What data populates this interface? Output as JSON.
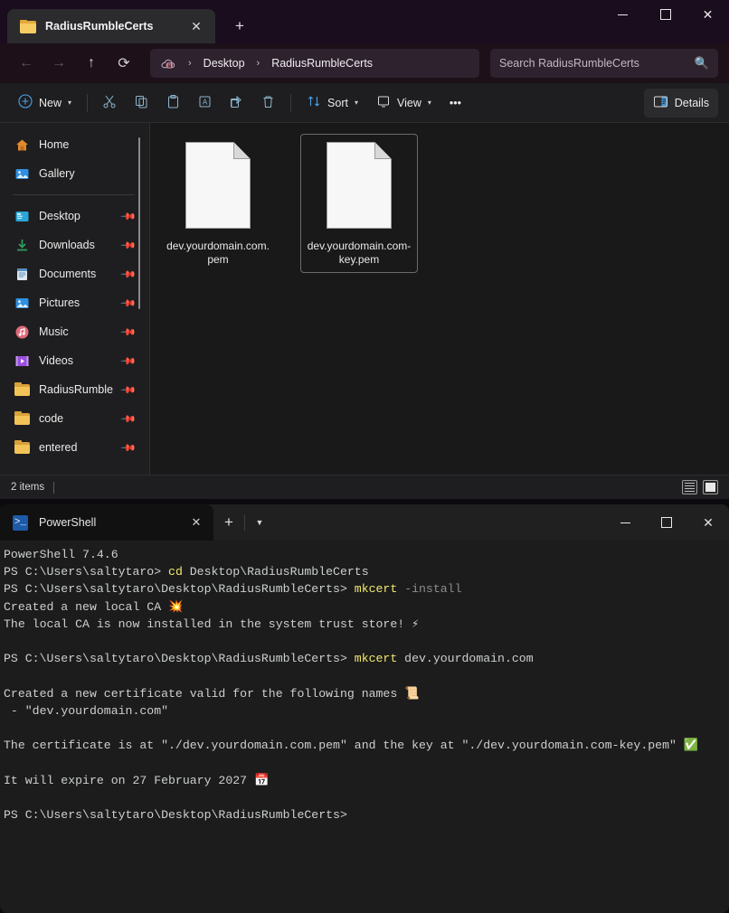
{
  "explorer": {
    "tab": {
      "title": "RadiusRumbleCerts",
      "folder_icon": "folder-icon",
      "close_icon": "close-icon"
    },
    "new_tab_icon": "plus-icon",
    "window_controls": {
      "minimize": "minimize-icon",
      "maximize": "maximize-icon",
      "close": "close-icon"
    },
    "nav": {
      "back_icon": "arrow-left-icon",
      "forward_icon": "arrow-right-icon",
      "up_icon": "arrow-up-icon",
      "refresh_icon": "refresh-icon"
    },
    "address": {
      "root_icon": "onedrive-lock-icon",
      "separator": "›",
      "crumbs": [
        "Desktop",
        "RadiusRumbleCerts"
      ]
    },
    "search": {
      "placeholder": "Search RadiusRumbleCerts",
      "icon": "search-icon"
    },
    "toolbar": {
      "new_label": "New",
      "new_icon": "plus-circle-icon",
      "cut_icon": "scissors-icon",
      "copy_icon": "copy-icon",
      "paste_icon": "paste-icon",
      "rename_icon": "rename-icon",
      "share_icon": "share-icon",
      "delete_icon": "trash-icon",
      "sort_label": "Sort",
      "sort_icon": "sort-arrows-icon",
      "view_label": "View",
      "view_icon": "monitor-icon",
      "more_label": "•••",
      "details_label": "Details",
      "details_icon": "details-pane-icon",
      "chevron": "⌄"
    },
    "sidebar": {
      "items": [
        {
          "label": "Home",
          "icon": "home-icon",
          "pinned": false
        },
        {
          "label": "Gallery",
          "icon": "gallery-icon",
          "pinned": false
        },
        {
          "divider": true
        },
        {
          "label": "Desktop",
          "icon": "desktop-icon",
          "pinned": true
        },
        {
          "label": "Downloads",
          "icon": "downloads-icon",
          "pinned": true
        },
        {
          "label": "Documents",
          "icon": "documents-icon",
          "pinned": true
        },
        {
          "label": "Pictures",
          "icon": "pictures-icon",
          "pinned": true
        },
        {
          "label": "Music",
          "icon": "music-icon",
          "pinned": true
        },
        {
          "label": "Videos",
          "icon": "videos-icon",
          "pinned": true
        },
        {
          "label": "RadiusRumble",
          "icon": "folder-icon",
          "pinned": true
        },
        {
          "label": "code",
          "icon": "folder-icon",
          "pinned": true
        },
        {
          "label": "entered",
          "icon": "folder-icon",
          "pinned": true
        }
      ],
      "pin_glyph": "✒"
    },
    "files": [
      {
        "name": "dev.yourdomain.com.pem",
        "icon": "generic-file-icon",
        "selected": false
      },
      {
        "name": "dev.yourdomain.com-key.pem",
        "icon": "generic-file-icon",
        "selected": true
      }
    ],
    "status": {
      "item_count": "2 items",
      "list_view_icon": "list-view-icon",
      "icons_view_icon": "large-icons-view-icon"
    }
  },
  "terminal": {
    "tab": {
      "title": "PowerShell",
      "icon": "powershell-icon",
      "close_icon": "close-icon"
    },
    "new_tab_icon": "plus-icon",
    "dropdown_icon": "chevron-down-icon",
    "window_controls": {
      "minimize": "minimize-icon",
      "maximize": "maximize-icon",
      "close": "close-icon"
    },
    "lines": [
      [
        {
          "t": "PowerShell 7.4.6",
          "c": "c-txt"
        }
      ],
      [
        {
          "t": "PS C:\\Users\\saltytaro> ",
          "c": "c-txt"
        },
        {
          "t": "cd",
          "c": "c-cmd"
        },
        {
          "t": " Desktop\\RadiusRumbleCerts",
          "c": "c-txt"
        }
      ],
      [
        {
          "t": "PS C:\\Users\\saltytaro\\Desktop\\RadiusRumbleCerts> ",
          "c": "c-txt"
        },
        {
          "t": "mkcert",
          "c": "c-cmd"
        },
        {
          "t": " ",
          "c": "c-txt"
        },
        {
          "t": "-install",
          "c": "c-dim"
        }
      ],
      [
        {
          "t": "Created a new local CA 💥",
          "c": "c-txt"
        }
      ],
      [
        {
          "t": "The local CA is now installed in the system trust store! ⚡",
          "c": "c-txt"
        }
      ],
      [
        {
          "t": "",
          "c": "c-txt"
        }
      ],
      [
        {
          "t": "PS C:\\Users\\saltytaro\\Desktop\\RadiusRumbleCerts> ",
          "c": "c-txt"
        },
        {
          "t": "mkcert",
          "c": "c-cmd"
        },
        {
          "t": " dev.yourdomain.com",
          "c": "c-txt"
        }
      ],
      [
        {
          "t": "",
          "c": "c-txt"
        }
      ],
      [
        {
          "t": "Created a new certificate valid for the following names 📜",
          "c": "c-txt"
        }
      ],
      [
        {
          "t": " - \"dev.yourdomain.com\"",
          "c": "c-txt"
        }
      ],
      [
        {
          "t": "",
          "c": "c-txt"
        }
      ],
      [
        {
          "t": "The certificate is at \"./dev.yourdomain.com.pem\" and the key at \"./dev.yourdomain.com-key.pem\" ✅",
          "c": "c-txt"
        }
      ],
      [
        {
          "t": "",
          "c": "c-txt"
        }
      ],
      [
        {
          "t": "It will expire on 27 February 2027 📅",
          "c": "c-txt"
        }
      ],
      [
        {
          "t": "",
          "c": "c-txt"
        }
      ],
      [
        {
          "t": "PS C:\\Users\\saltytaro\\Desktop\\RadiusRumbleCerts>",
          "c": "c-txt"
        }
      ]
    ]
  }
}
